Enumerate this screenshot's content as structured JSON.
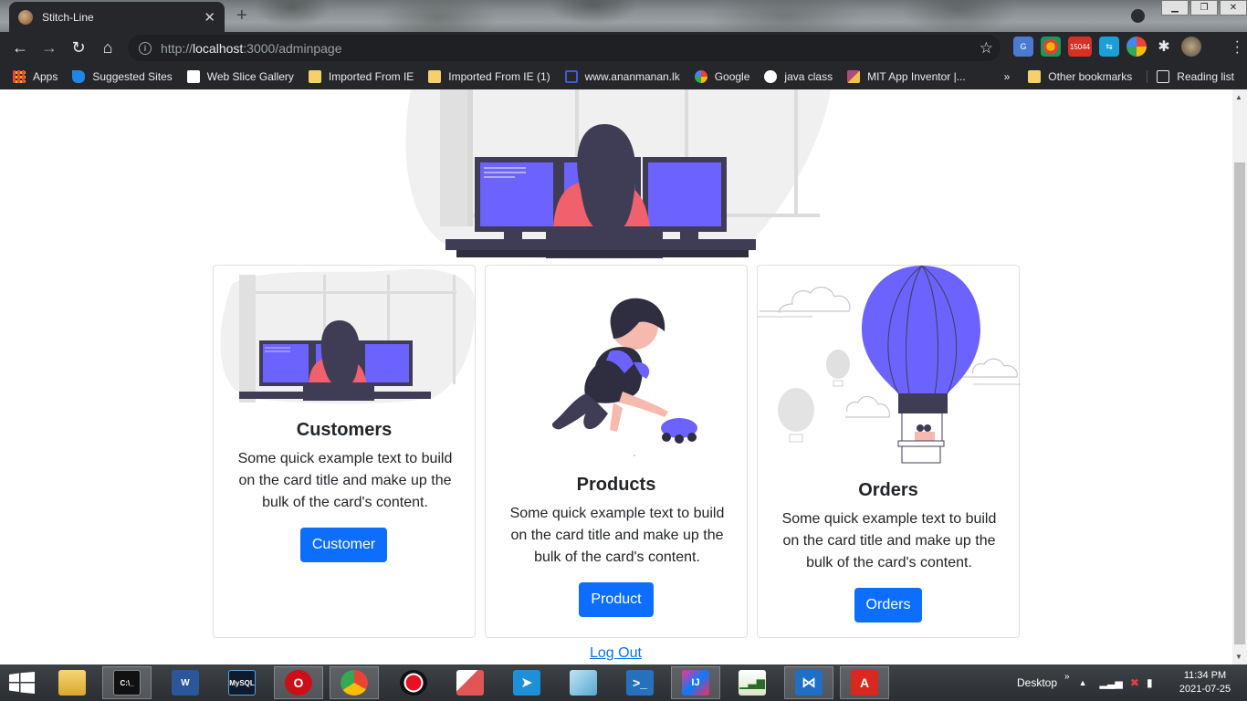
{
  "browser": {
    "tab_title": "Stitch-Line",
    "tab_close": "✕",
    "new_tab": "+",
    "url_scheme": "http://",
    "url_host": "localhost",
    "url_path": ":3000/adminpage",
    "ext_badge": "15044"
  },
  "bookmarks": [
    {
      "label": "Apps",
      "color": "#e8453c"
    },
    {
      "label": "Suggested Sites",
      "color": "#1e88e5"
    },
    {
      "label": "Web Slice Gallery",
      "color": "#ffffff"
    },
    {
      "label": "Imported From IE",
      "color": "#f6d06b"
    },
    {
      "label": "Imported From IE (1)",
      "color": "#f6d06b"
    },
    {
      "label": "www.ananmanan.lk",
      "color": "#3b5bdb"
    },
    {
      "label": "Google",
      "color": "#4285f4"
    },
    {
      "label": "java class",
      "color": "#ffffff"
    },
    {
      "label": "MIT App Inventor |...",
      "color": "#b04a7a"
    }
  ],
  "bookmarks_more": "»",
  "bookmarks_other": "Other bookmarks",
  "bookmarks_reading": "Reading list",
  "cards": {
    "customers": {
      "title": "Customers",
      "text": "Some quick example text to build on the card title and make up the bulk of the card's content.",
      "button": "Customer"
    },
    "products": {
      "title": "Products",
      "text": "Some quick example text to build on the card title and make up the bulk of the card's content.",
      "button": "Product"
    },
    "orders": {
      "title": "Orders",
      "text": "Some quick example text to build on the card title and make up the bulk of the card's content.",
      "button": "Orders"
    }
  },
  "logout": "Log Out",
  "taskbar": {
    "desktop_label": "Desktop",
    "time": "11:34 PM",
    "date": "2021-07-25"
  },
  "colors": {
    "accent": "#0d6efd",
    "illustration_purple": "#6c63ff",
    "illustration_pink": "#f0606d",
    "illustration_dark": "#3f3d56"
  }
}
